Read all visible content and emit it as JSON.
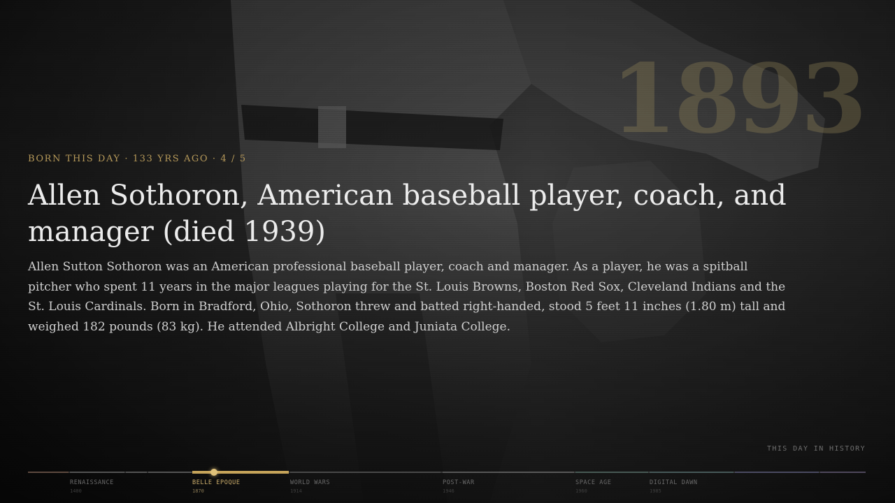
{
  "year": "1893",
  "eyebrow": "BORN THIS DAY · 133 YRS AGO · 4 / 5",
  "headline": "Allen Sothoron, American baseball player, coach, and manager (died 1939)",
  "summary": "Allen Sutton Sothoron was an American professional baseball player, coach and manager. As a player, he was a spitball pitcher who spent 11 years in the major leagues playing for the St. Louis Browns, Boston Red Sox, Cleveland Indians and the St. Louis Cardinals. Born in Bradford, Ohio, Sothoron threw and batted right-handed, stood 5 feet 11 inches (1.80 m) tall and weighed 182 pounds (83 kg). He attended Albright College and Juniata College.",
  "site_label": "THIS DAY IN HISTORY",
  "timeline": {
    "eras": [
      {
        "name": "RENAISSANCE",
        "year": "1400"
      },
      {
        "name": "BELLE EPOQUE",
        "year": "1870",
        "active": true
      },
      {
        "name": "WORLD WARS",
        "year": "1914"
      },
      {
        "name": "POST-WAR",
        "year": "1946"
      },
      {
        "name": "SPACE AGE",
        "year": "1960"
      },
      {
        "name": "DIGITAL DAWN",
        "year": "1985"
      }
    ]
  },
  "colors": {
    "accent": "#c6a45a",
    "background": "#232323",
    "headline": "#ececec"
  },
  "background_image": "vintage-baseball-pitcher-photo"
}
